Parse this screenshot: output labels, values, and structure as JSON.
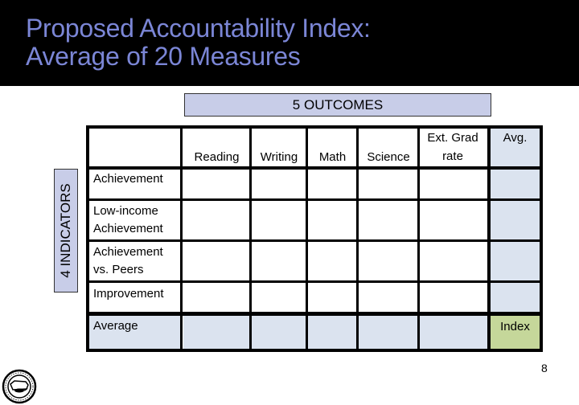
{
  "title": {
    "line1": "Proposed Accountability Index:",
    "line2": "Average of 20 Measures",
    "color": "#7b86d6"
  },
  "outcomes_label": "5 OUTCOMES",
  "indicators_label": "4 INDICATORS",
  "table": {
    "columns": [
      "Reading",
      "Writing",
      "Math",
      "Science",
      "Ext. Grad rate",
      "Avg."
    ],
    "rows": [
      {
        "label": "Achievement",
        "cells": [
          "",
          "",
          "",
          "",
          "",
          ""
        ]
      },
      {
        "label": "Low-income Achievement",
        "cells": [
          "",
          "",
          "",
          "",
          "",
          ""
        ]
      },
      {
        "label": "Achievement vs. Peers",
        "cells": [
          "",
          "",
          "",
          "",
          "",
          ""
        ]
      },
      {
        "label": "Improvement",
        "cells": [
          "",
          "",
          "",
          "",
          "",
          ""
        ]
      },
      {
        "label": "Average",
        "cells": [
          "",
          "",
          "",
          "",
          "",
          "Index"
        ]
      }
    ],
    "colors": {
      "average_fill": "#dbe3ef",
      "index_fill": "#c5d79a",
      "header_box_fill": "#c8cde8"
    }
  },
  "page_number": "8",
  "logo_icon": "state-seal-icon"
}
